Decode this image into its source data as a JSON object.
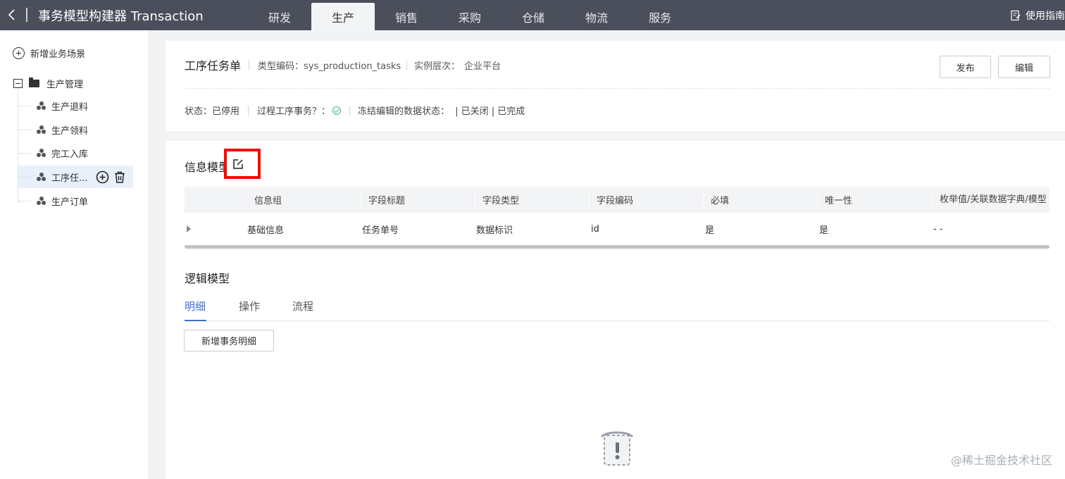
{
  "header": {
    "back_icon": "chevron-left-icon",
    "app_title": "事务模型构建器 Transaction",
    "nav": [
      "研发",
      "生产",
      "销售",
      "采购",
      "仓储",
      "物流",
      "服务"
    ],
    "active_nav": "生产",
    "guide_label": "使用指南",
    "guide_icon": "edit-doc-icon"
  },
  "sidebar": {
    "add_scene_label": "新增业务场景",
    "root_label": "生产管理",
    "items": [
      {
        "label": "生产退料"
      },
      {
        "label": "生产领料"
      },
      {
        "label": "完工入库"
      },
      {
        "label": "工序任..."
      },
      {
        "label": "生产订单"
      }
    ],
    "selected_index": 3
  },
  "doc": {
    "title": "工序任务单",
    "type_code_label": "类型编码：",
    "type_code": "sys_production_tasks",
    "instance_level_label": "实例层次：",
    "instance_level": "企业平台",
    "publish_label": "发布",
    "edit_label": "编辑",
    "status_label": "状态：",
    "status_value": "已停用",
    "process_label": "过程工序事务？：",
    "freeze_label": "冻结编辑的数据状态：",
    "freeze_values": "| 已关闭 | 已完成"
  },
  "info_model": {
    "title": "信息模型",
    "columns": [
      "信息组",
      "字段标题",
      "字段类型",
      "字段编码",
      "必填",
      "唯一性",
      "枚举值/关联数据字典/模型"
    ],
    "rows": [
      [
        "基础信息",
        "任务单号",
        "数据标识",
        "id",
        "是",
        "是",
        "- -"
      ]
    ]
  },
  "logic_model": {
    "title": "逻辑模型",
    "tabs": [
      "明细",
      "操作",
      "流程"
    ],
    "active_tab": "明细",
    "add_detail_label": "新增事务明细"
  },
  "watermark": "@稀土掘金技术社区",
  "colors": {
    "header_bg": "#4a4f5b",
    "accent": "#3c6fd1",
    "highlight": "#ff0000"
  }
}
